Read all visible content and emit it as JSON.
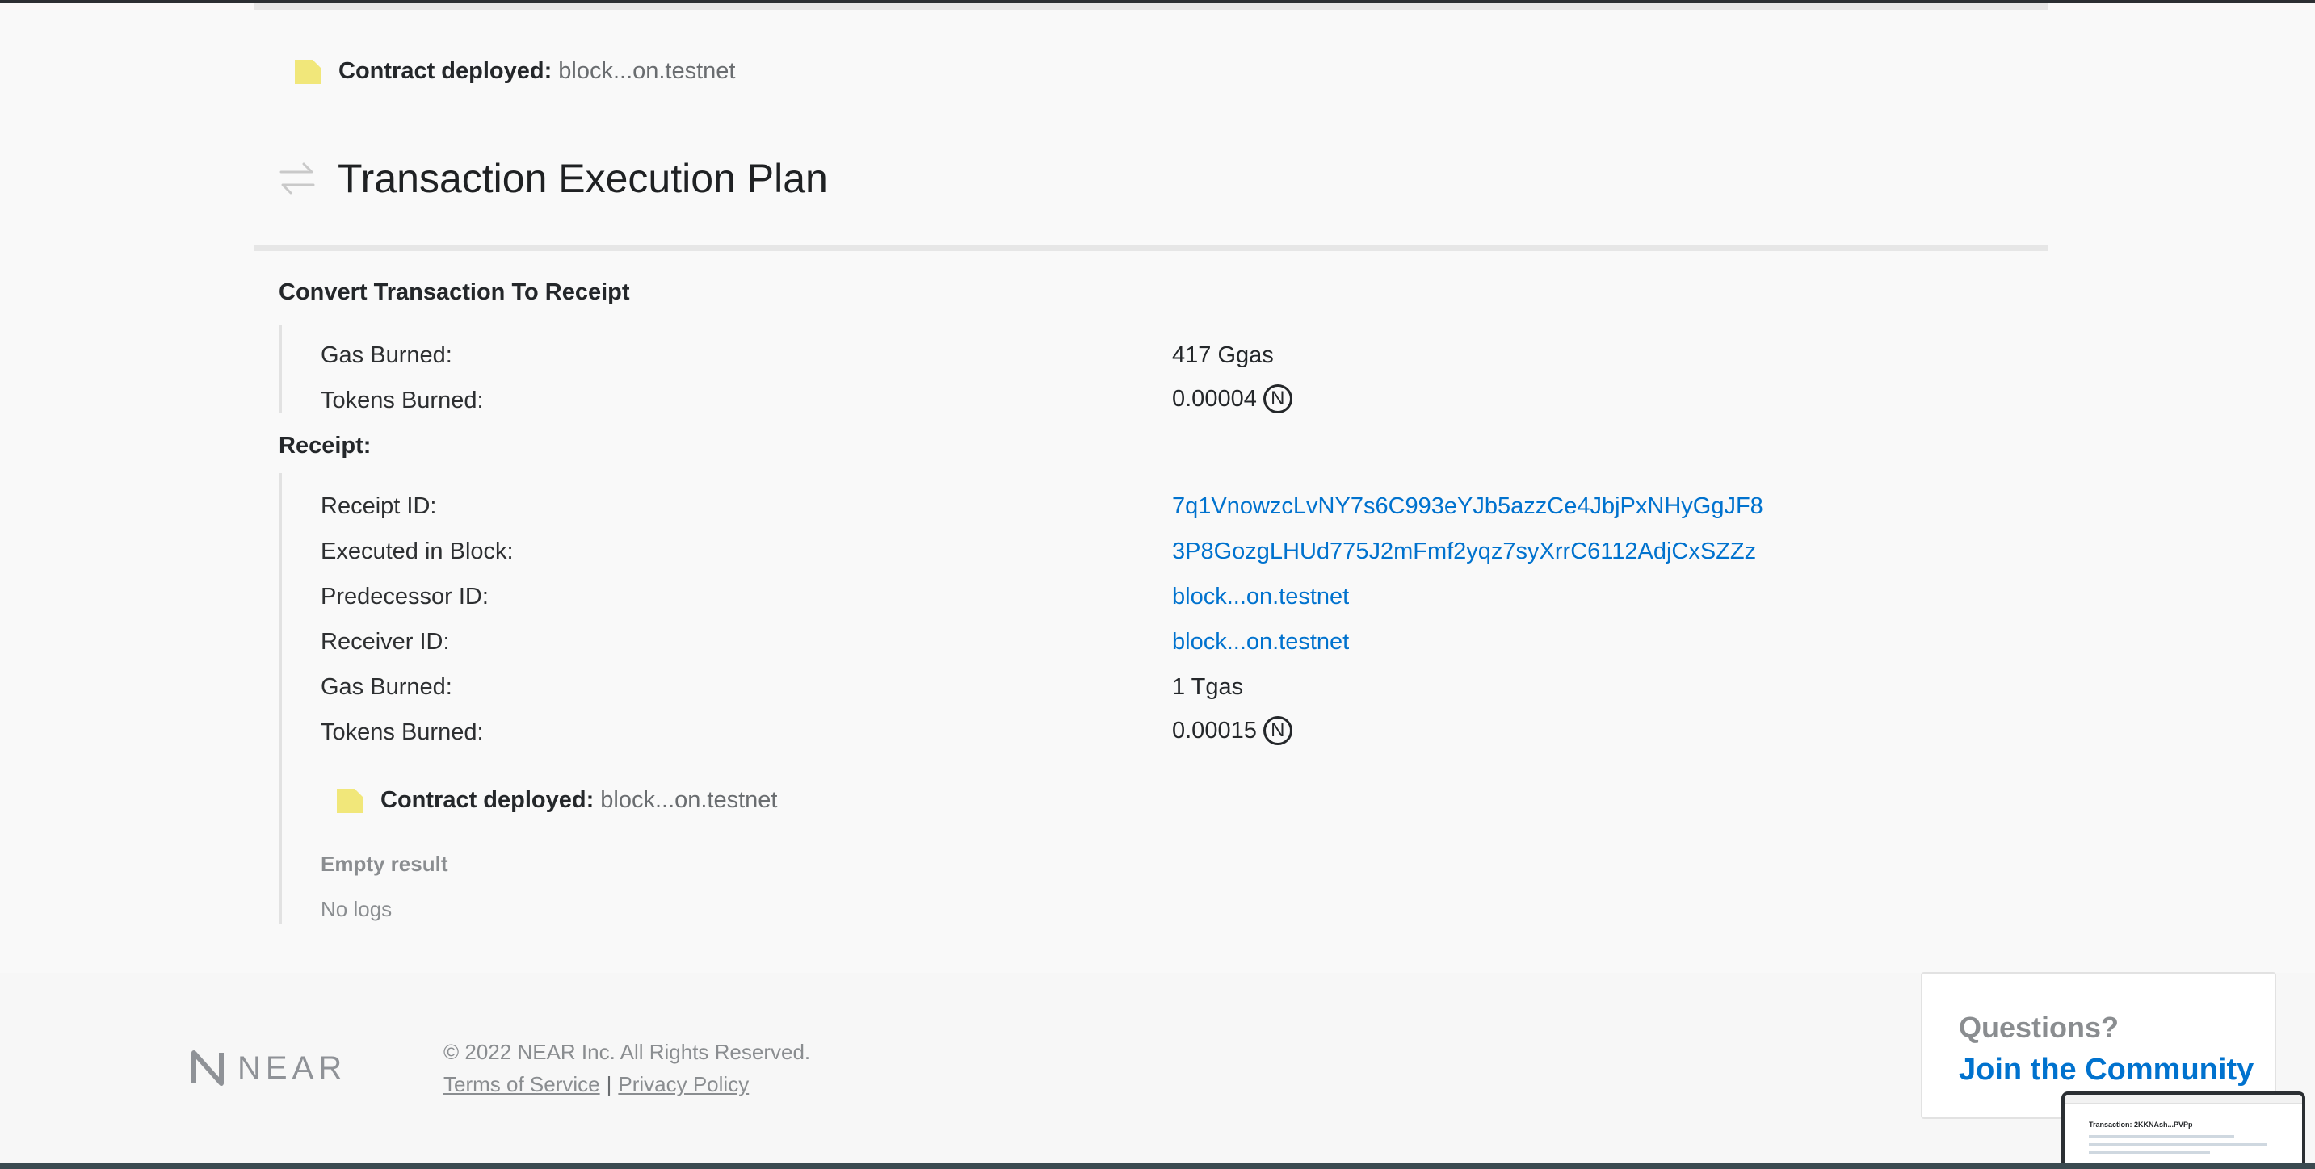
{
  "colors": {
    "link": "#0072ce",
    "sticky": "#f1e77a"
  },
  "top_deploy": {
    "label": "Contract deployed:",
    "value": "block...on.testnet",
    "icon": "sticky-note-icon"
  },
  "section": {
    "title": "Transaction Execution Plan",
    "icon": "arrows-exchange-icon"
  },
  "convert": {
    "heading": "Convert Transaction To Receipt",
    "rows": [
      {
        "label": "Gas Burned:",
        "value": "417 Ggas"
      },
      {
        "label": "Tokens Burned:",
        "value": "0.00004",
        "symbol": "N"
      }
    ]
  },
  "receipt": {
    "heading": "Receipt:",
    "rows": [
      {
        "label": "Receipt ID:",
        "value": "7q1VnowzcLvNY7s6C993eYJb5azzCe4JbjPxNHyGgJF8"
      },
      {
        "label": "Executed in Block:",
        "value": "3P8GozgLHUd775J2mFmf2yqz7syXrrC6112AdjCxSZZz"
      },
      {
        "label": "Predecessor ID:",
        "value": "block...on.testnet"
      },
      {
        "label": "Receiver ID:",
        "value": "block...on.testnet"
      },
      {
        "label": "Gas Burned:",
        "value": "1 Tgas"
      },
      {
        "label": "Tokens Burned:",
        "value": "0.00015",
        "symbol": "N"
      }
    ],
    "deploy": {
      "label": "Contract deployed:",
      "value": "block...on.testnet"
    },
    "result": "Empty result",
    "logs": "No logs"
  },
  "footer": {
    "logo_text": "NEAR",
    "copyright": "© 2022 NEAR Inc. All Rights Reserved.",
    "terms": "Terms of Service",
    "privacy": "Privacy Policy",
    "separator": "|"
  },
  "community": {
    "question": "Questions?",
    "link": "Join the Community"
  },
  "thumbnail": {
    "title": "Transaction: 2KKNAsh...PVPp"
  }
}
